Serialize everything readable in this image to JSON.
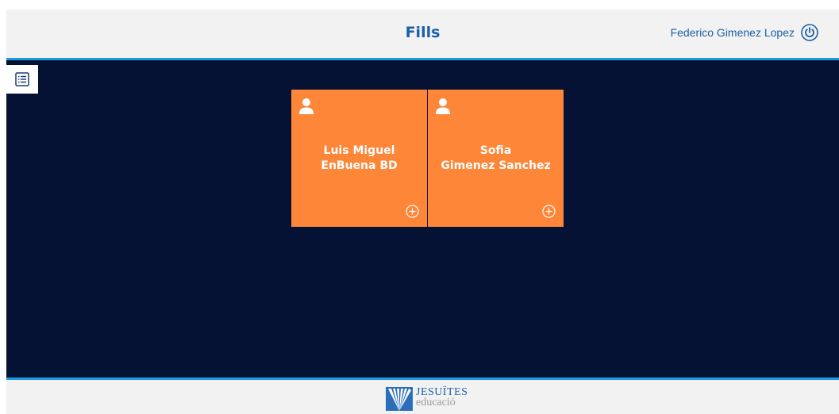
{
  "header": {
    "title": "Fills",
    "user_name": "Federico Gimenez Lopez",
    "logout_icon": "power-icon"
  },
  "toolbar": {
    "list_icon": "list-icon"
  },
  "children": [
    {
      "first_line": "Luis Miguel",
      "second_line": "EnBuena BD"
    },
    {
      "first_line": "Sofia",
      "second_line": "Gimenez Sanchez"
    }
  ],
  "footer": {
    "logo_main": "JESUÏTES",
    "logo_sub": "educació"
  },
  "colors": {
    "accent": "#1e9be0",
    "brand_text": "#1a5fa8",
    "card": "#fd8638",
    "background": "#061233",
    "bar": "#f2f2f2"
  }
}
